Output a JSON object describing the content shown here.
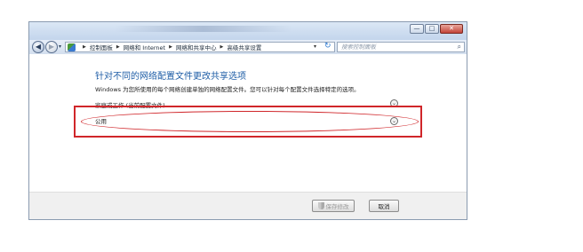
{
  "window": {
    "caption_buttons": {
      "minimize": "—",
      "maximize": "□",
      "close": "✕"
    }
  },
  "navigation": {
    "back_icon": "back-arrow-icon",
    "forward_icon": "forward-arrow-icon",
    "dropdown_glyph": "▾",
    "breadcrumb": [
      "控制面板",
      "网络和 Internet",
      "网络和共享中心",
      "高级共享设置"
    ],
    "separator": "▶",
    "refresh_glyph": "↻",
    "search_placeholder": "搜索控制面板"
  },
  "content": {
    "title": "针对不同的网络配置文件更改共享选项",
    "description": "Windows 为您所使用的每个网络创建单独的网络配置文件。您可以针对每个配置文件选择特定的选项。",
    "profiles": [
      {
        "label": "家庭或工作 (当前配置文件)",
        "expander": "⌄"
      },
      {
        "label": "公用",
        "expander": "⌄"
      }
    ]
  },
  "annotation": {
    "color": "#d0262a"
  },
  "footer": {
    "save_label": "保存修改",
    "cancel_label": "取消"
  }
}
